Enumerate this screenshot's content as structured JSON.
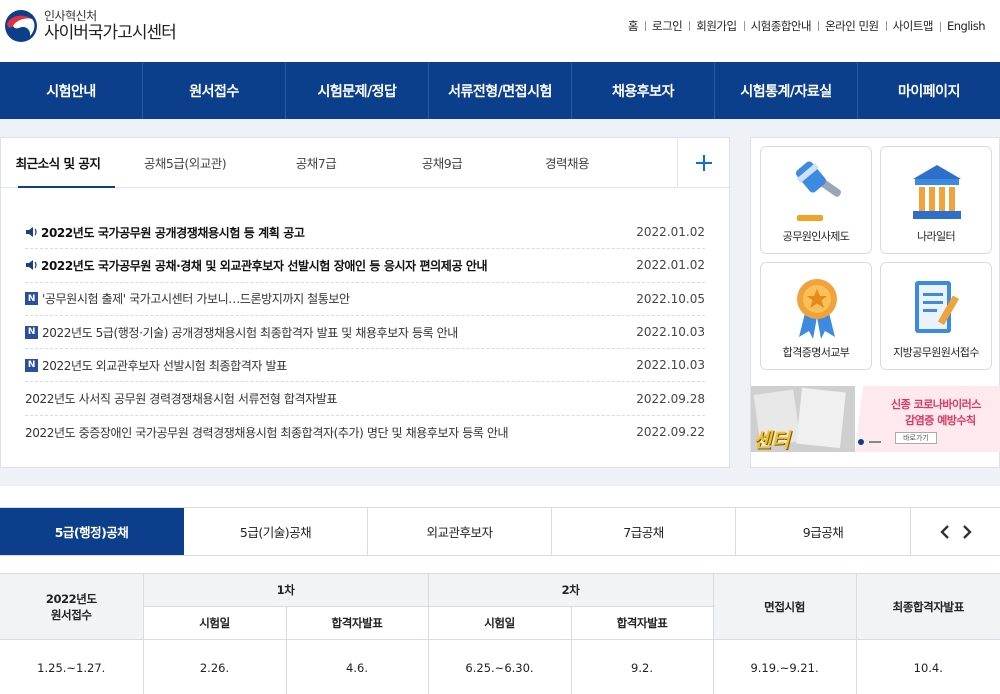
{
  "header": {
    "logo_sub": "인사혁신처",
    "logo_main": "사이버국가고시센터",
    "util": [
      "홈",
      "로그인",
      "회원가입",
      "시험종합안내",
      "온라인 민원",
      "사이트맵",
      "English"
    ]
  },
  "gnb": [
    "시험안내",
    "원서접수",
    "시험문제/정답",
    "서류전형/면접시험",
    "채용후보자",
    "시험통계/자료실",
    "마이페이지"
  ],
  "notice": {
    "tabs": [
      "최근소식 및 공지",
      "공채5급(외교관)",
      "공채7급",
      "공채9급",
      "경력채용"
    ],
    "items": [
      {
        "title": "2022년도 국가공무원 공개경쟁채용시험 등 계획 공고",
        "date": "2022.01.02"
      },
      {
        "title": "2022년도 국가공무원 공채·경채 및 외교관후보자 선발시험 장애인 등 응시자 편의제공 안내",
        "date": "2022.01.02"
      },
      {
        "title": "'공무원시험 출제' 국가고시센터 가보니…드론방지까지 철통보안",
        "date": "2022.10.05"
      },
      {
        "title": "2022년도 5급(행정·기술) 공개경쟁채용시험 최종합격자 발표 및 채용후보자 등록 안내",
        "date": "2022.10.03"
      },
      {
        "title": "2022년도 외교관후보자 선발시험 최종합격자 발표",
        "date": "2022.10.03"
      },
      {
        "title": "2022년도 사서직 공무원 경력경쟁채용시험 서류전형 합격자발표",
        "date": "2022.09.28"
      },
      {
        "title": "2022년도 중증장애인 국가공무원 경력경쟁채용시험 최종합격자(추가) 명단 및 채용후보자 등록 안내",
        "date": "2022.09.22"
      }
    ],
    "badge": "N"
  },
  "quick": {
    "items": [
      "공무원인사제도",
      "나라일터",
      "합격증명서교부",
      "지방공무원원서접수"
    ],
    "banner": {
      "left_text": "센터",
      "line1": "신종 코로나바이러스",
      "line2": "감염증 예방수칙",
      "button": "바로가기"
    }
  },
  "exam_tabs": [
    "5급(행정)공채",
    "5급(기술)공채",
    "외교관후보자",
    "7급공채",
    "9급공채"
  ],
  "schedule": {
    "col_apply": "2022년도\n원서접수",
    "group1": "1차",
    "group2": "2차",
    "col_interview": "면접시험",
    "col_final": "최종합격자발표",
    "sub_exam": "시험일",
    "sub_result": "합격자발표",
    "row": [
      "1.25.~1.27.",
      "2.26.",
      "4.6.",
      "6.25.~6.30.",
      "9.2.",
      "9.19.~9.21.",
      "10.4."
    ]
  },
  "colors": {
    "navy": "#0b3f8c",
    "accent": "#0b6fd1",
    "pink": "#d63a64"
  }
}
